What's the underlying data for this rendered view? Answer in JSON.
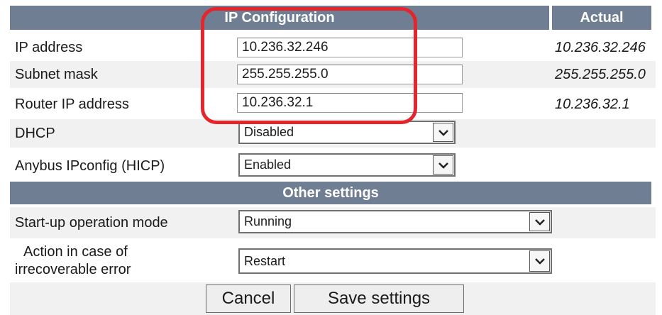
{
  "header": {
    "title": "IP Configuration",
    "actual_label": "Actual"
  },
  "ip_fields": [
    {
      "label": "IP address",
      "value": "10.236.32.246",
      "actual": "10.236.32.246"
    },
    {
      "label": "Subnet mask",
      "value": "255.255.255.0",
      "actual": "255.255.255.0"
    },
    {
      "label": "Router IP address",
      "value": "10.236.32.1",
      "actual": "10.236.32.1"
    }
  ],
  "dhcp": {
    "label": "DHCP",
    "selected": "Disabled"
  },
  "hicp": {
    "label": "Anybus IPconfig (HICP)",
    "selected": "Enabled"
  },
  "other_settings": {
    "title": "Other settings"
  },
  "startup": {
    "label": "Start-up operation mode",
    "selected": "Running"
  },
  "error_action": {
    "label_line1": "Action in case of",
    "label_line2": "irrecoverable error",
    "selected": "Restart"
  },
  "buttons": {
    "cancel": "Cancel",
    "save": "Save settings"
  },
  "colors": {
    "header_bg": "#6f7e92",
    "row_band": "#f1f1f1",
    "highlight": "#e3262b"
  },
  "icons": {
    "dropdown": "chevron-down-icon"
  }
}
